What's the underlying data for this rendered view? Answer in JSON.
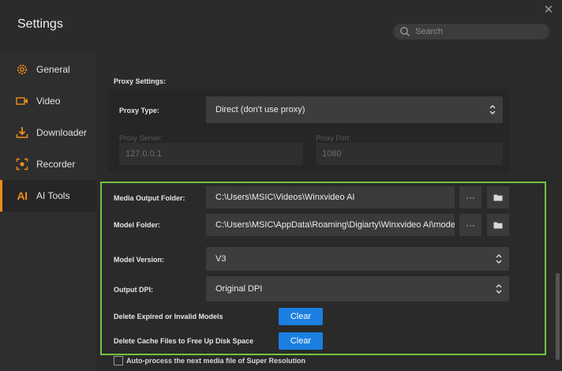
{
  "window": {
    "title": "Settings"
  },
  "search": {
    "placeholder": "Search"
  },
  "sidebar": {
    "items": [
      {
        "label": "General",
        "icon": "gear-icon"
      },
      {
        "label": "Video",
        "icon": "video-camera-icon"
      },
      {
        "label": "Downloader",
        "icon": "download-icon"
      },
      {
        "label": "Recorder",
        "icon": "record-icon"
      },
      {
        "label": "AI Tools",
        "icon": "ai-icon",
        "active": true
      }
    ]
  },
  "proxy": {
    "section_title": "Proxy Settings:",
    "type_label": "Proxy Type:",
    "type_value": "Direct (don't use proxy)",
    "server_label": "Proxy Server:",
    "server_value": "127.0.0.1",
    "port_label": "Proxy Port:",
    "port_value": "1080"
  },
  "ai_tools": {
    "media_output_label": "Media Output Folder:",
    "media_output_value": "C:\\Users\\MSIC\\Videos\\Winxvideo AI",
    "model_folder_label": "Model Folder:",
    "model_folder_value": "C:\\Users\\MSIC\\AppData\\Roaming\\Digiarty\\Winxvideo AI\\models",
    "browse_dots": "···",
    "model_version_label": "Model Version:",
    "model_version_value": "V3",
    "output_dpi_label": "Output DPI:",
    "output_dpi_value": "Original DPI",
    "delete_models_label": "Delete Expired or Invalid Models",
    "delete_cache_label": "Delete Cache Files to Free Up Disk Space",
    "clear_label": "Clear"
  },
  "footer": {
    "auto_process_label": "Auto-process the next media file of Super Resolution",
    "auto_process_checked": false
  },
  "colors": {
    "accent": "#f08c1a",
    "button_blue": "#1a7fe0",
    "highlight_border": "#72c43e"
  }
}
